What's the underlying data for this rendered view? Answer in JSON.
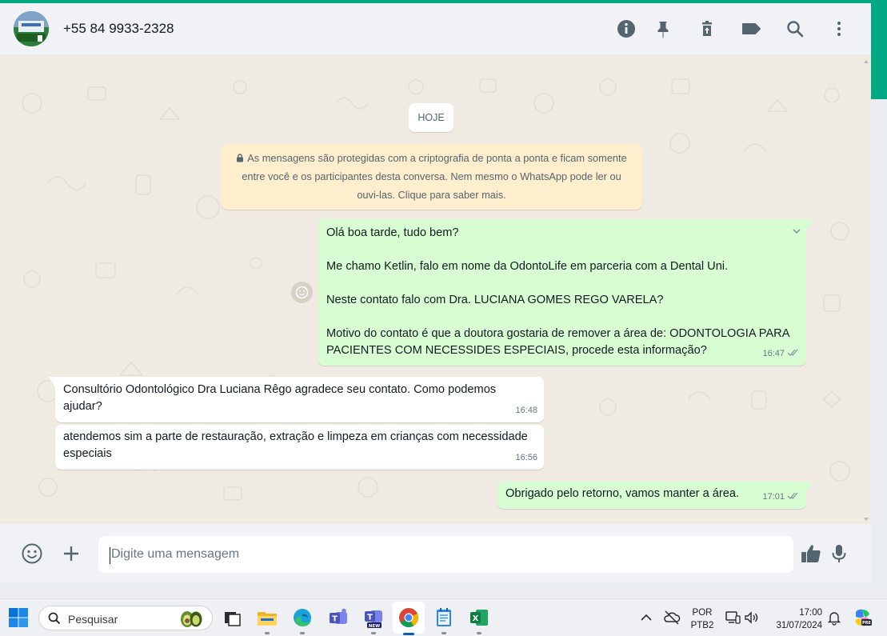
{
  "header": {
    "contact_name": "+55 84 9933-2328",
    "icons": [
      "info-icon",
      "pin-icon",
      "delete-icon",
      "label-icon",
      "search-icon",
      "menu-icon"
    ]
  },
  "chat": {
    "date_chip": "HOJE",
    "encryption_notice": "As mensagens são protegidas com a criptografia de ponta a ponta e ficam somente entre você e os participantes desta conversa. Nem mesmo o WhatsApp pode ler ou ouvi-las. Clique para saber mais.",
    "messages": [
      {
        "direction": "out",
        "paragraphs": [
          "Olá boa tarde, tudo bem?",
          "Me chamo Ketlin, falo em nome da OdontoLife em parceria com a Dental Uni.",
          "Neste contato falo com Dra. LUCIANA GOMES REGO VARELA?",
          "Motivo do contato é que a doutora gostaria de remover a área de: ODONTOLOGIA PARA PACIENTES COM NECESSIDES ESPECIAIS, procede esta informação?"
        ],
        "time": "16:47",
        "status": "read"
      },
      {
        "direction": "in",
        "text": "Consultório Odontológico Dra Luciana Rêgo agradece seu contato. Como podemos ajudar?",
        "time": "16:48"
      },
      {
        "direction": "in",
        "text": "atendemos sim a parte de restauração, extração e limpeza em crianças com necessidade especiais",
        "time": "16:56"
      },
      {
        "direction": "out",
        "text": "Obrigado pelo retorno, vamos manter a área.",
        "time": "17:01",
        "status": "read"
      }
    ]
  },
  "composer": {
    "placeholder": "Digite uma mensagem",
    "value": ""
  },
  "taskbar": {
    "search_label": "Pesquisar",
    "lang_line1": "POR",
    "lang_line2": "PTB2",
    "time": "17:00",
    "date": "31/07/2024",
    "apps": [
      "start-icon",
      "search-icon",
      "task-view-icon",
      "file-explorer-icon",
      "edge-icon",
      "teams-icon",
      "teams-new-icon",
      "chrome-icon",
      "notepad-icon",
      "excel-icon"
    ]
  },
  "colors": {
    "accent": "#00a884",
    "outgoing_bubble": "#d9fdd3",
    "incoming_bubble": "#ffffff",
    "chat_bg": "#efeae2",
    "notice_bg": "#ffeecd",
    "read_ticks": "#53bdeb"
  }
}
